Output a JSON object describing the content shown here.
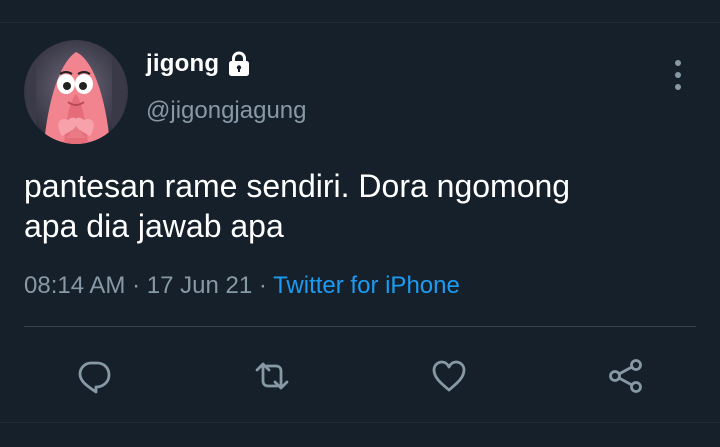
{
  "author": {
    "display_name": "jigong",
    "handle": "@jigongjagung",
    "avatar_icon": "patrick-star-avatar",
    "protected_icon": "lock-icon"
  },
  "tweet": {
    "text": "pantesan rame sendiri. Dora ngomong\napa dia jawab apa",
    "time": "08:14 AM",
    "separator": "·",
    "date": "17 Jun 21",
    "source": "Twitter for iPhone"
  },
  "actions": [
    {
      "name": "reply",
      "icon": "reply-icon"
    },
    {
      "name": "retweet",
      "icon": "retweet-icon"
    },
    {
      "name": "like",
      "icon": "heart-icon"
    },
    {
      "name": "share",
      "icon": "share-icon"
    }
  ],
  "colors": {
    "background": "#15202b",
    "text_primary": "#ffffff",
    "text_secondary": "#8899a6",
    "link": "#1d9bf0",
    "divider": "#38444d"
  }
}
